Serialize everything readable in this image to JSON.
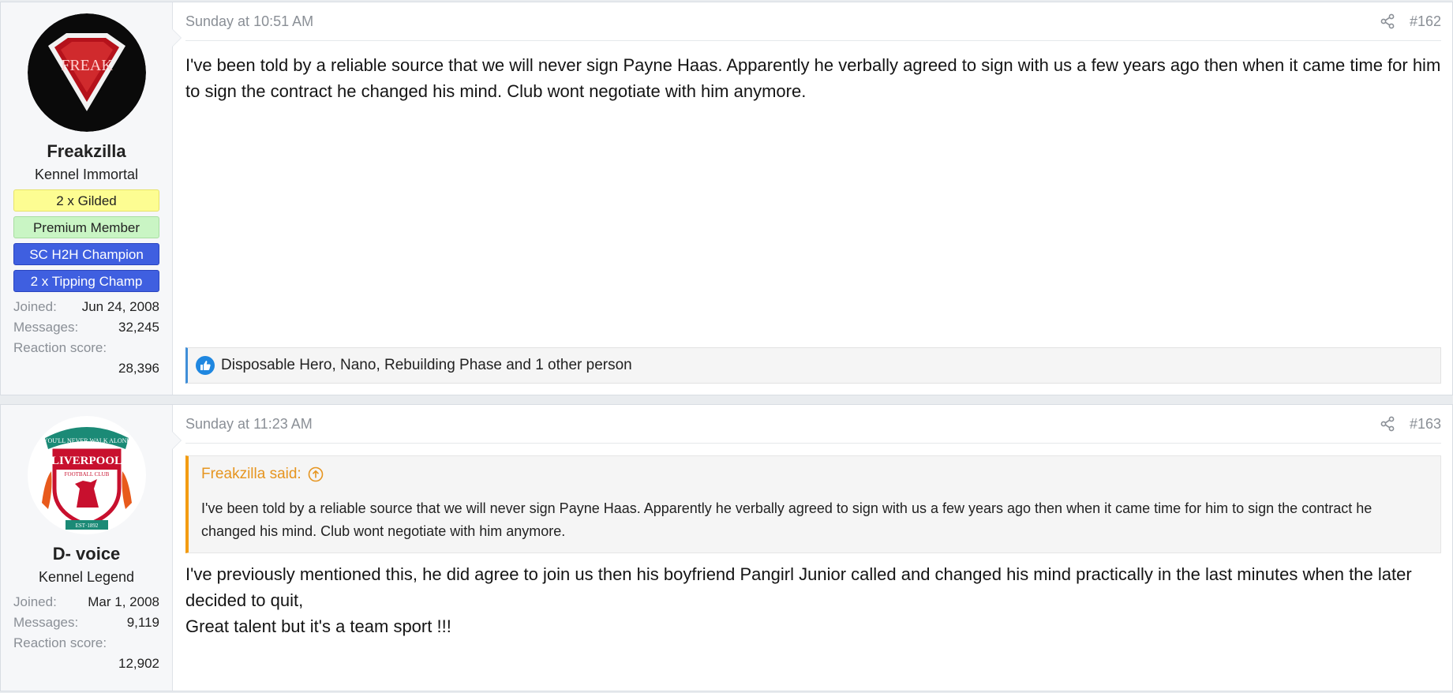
{
  "posts": [
    {
      "username": "Freakzilla",
      "user_title": "Kennel Immortal",
      "avatar_text": "FREAK",
      "banners": [
        "2 x Gilded",
        "Premium Member",
        "SC H2H Champion",
        "2 x Tipping Champ"
      ],
      "stats": {
        "joined_label": "Joined:",
        "joined": "Jun 24, 2008",
        "messages_label": "Messages:",
        "messages": "32,245",
        "reaction_label": "Reaction score:",
        "reaction": "28,396"
      },
      "date": "Sunday at 10:51 AM",
      "number": "#162",
      "body": "I've been told by a reliable source that we will never sign Payne Haas. Apparently he verbally agreed to sign with us a few years ago then when it came time for him to sign the contract he changed his mind. Club wont negotiate with him anymore.",
      "reactions": "Disposable Hero, Nano, Rebuilding Phase and 1 other person"
    },
    {
      "username": "D- voice",
      "user_title": "Kennel Legend",
      "avatar_text": [
        "YOU'LL NEVER WALK ALONE",
        "LIVERPOOL",
        "FOOTBALL CLUB",
        "EST·1892"
      ],
      "stats": {
        "joined_label": "Joined:",
        "joined": "Mar 1, 2008",
        "messages_label": "Messages:",
        "messages": "9,119",
        "reaction_label": "Reaction score:",
        "reaction": "12,902"
      },
      "date": "Sunday at 11:23 AM",
      "number": "#163",
      "quote_author": "Freakzilla said:",
      "quote_body": "I've been told by a reliable source that we will never sign Payne Haas. Apparently he verbally agreed to sign with us a few years ago then when it came time for him to sign the contract he changed his mind. Club wont negotiate with him anymore.",
      "body_line1": "I've previously mentioned this, he did agree to join us then his boyfriend Pangirl Junior called and changed his mind practically in the last minutes when the later decided to quit,",
      "body_line2": "Great talent but it's a team sport !!!"
    }
  ],
  "colors": {
    "accent_link": "#e69520",
    "reaction_bar": "#3f8ed8",
    "banner_blue": "#3f5fe0",
    "banner_gilded": "#fdfd92",
    "banner_premium": "#c9f5c4"
  },
  "icons": [
    "share-icon",
    "like-icon",
    "quote-jump-icon"
  ]
}
